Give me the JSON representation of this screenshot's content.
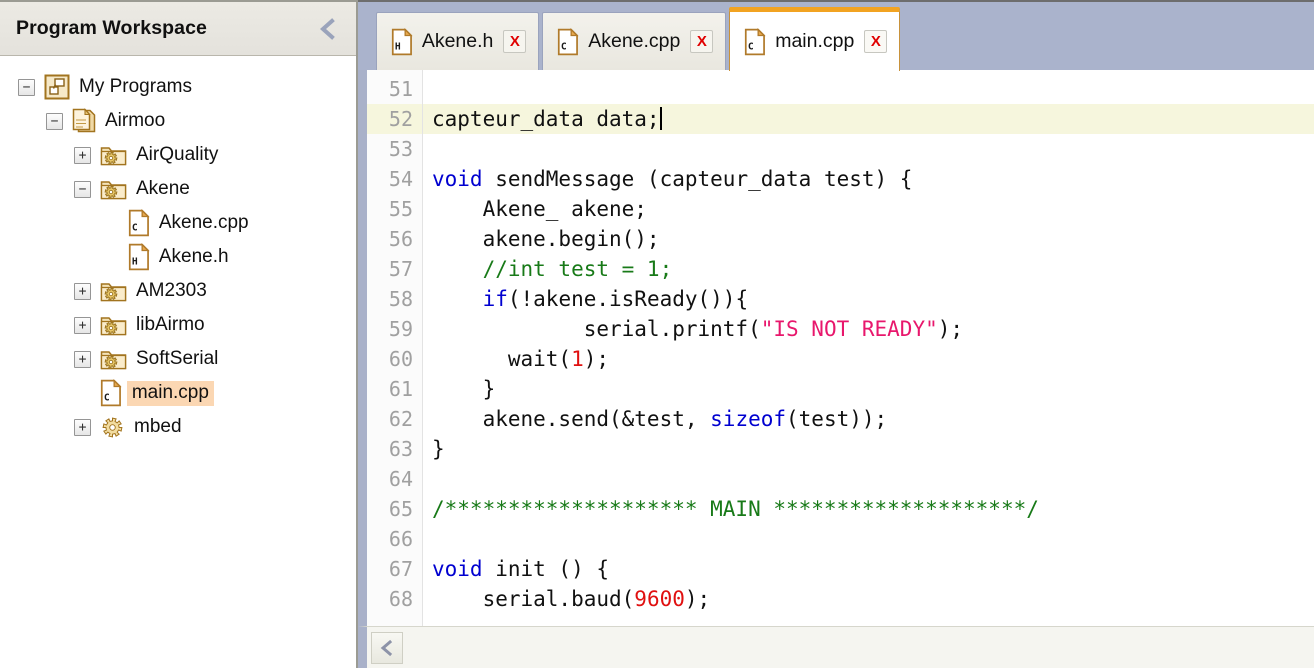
{
  "sidebar": {
    "title": "Program Workspace",
    "collapse_icon": "chevron-left-icon",
    "tree": [
      {
        "label": "My Programs",
        "icon": "programs-icon",
        "toggle": "−",
        "indent": 0,
        "selected": false
      },
      {
        "label": "Airmoo",
        "icon": "program-icon",
        "toggle": "−",
        "indent": 1,
        "selected": false
      },
      {
        "label": "AirQuality",
        "icon": "library-icon",
        "toggle": "+",
        "indent": 2,
        "selected": false
      },
      {
        "label": "Akene",
        "icon": "library-icon",
        "toggle": "−",
        "indent": 2,
        "selected": false
      },
      {
        "label": "Akene.cpp",
        "icon": "cpp-file-icon",
        "toggle": "",
        "indent": 3,
        "selected": false
      },
      {
        "label": "Akene.h",
        "icon": "h-file-icon",
        "toggle": "",
        "indent": 3,
        "selected": false
      },
      {
        "label": "AM2303",
        "icon": "library-icon",
        "toggle": "+",
        "indent": 2,
        "selected": false
      },
      {
        "label": "libAirmo",
        "icon": "library-icon",
        "toggle": "+",
        "indent": 2,
        "selected": false
      },
      {
        "label": "SoftSerial",
        "icon": "library-icon",
        "toggle": "+",
        "indent": 2,
        "selected": false
      },
      {
        "label": "main.cpp",
        "icon": "cpp-file-icon",
        "toggle": "",
        "indent": 2,
        "selected": true
      },
      {
        "label": "mbed",
        "icon": "gear-icon",
        "toggle": "+",
        "indent": 2,
        "selected": false
      }
    ]
  },
  "editor": {
    "tabs": [
      {
        "label": "Akene.h",
        "icon": "h-file-icon",
        "close": "X",
        "active": false
      },
      {
        "label": "Akene.cpp",
        "icon": "cpp-file-icon",
        "close": "X",
        "active": false
      },
      {
        "label": "main.cpp",
        "icon": "cpp-file-icon",
        "close": "X",
        "active": true
      }
    ],
    "scroll_left_icon": "chevron-left-icon",
    "first_line_number": 51,
    "cursor_line": 52,
    "lines": [
      {
        "n": 51,
        "tokens": []
      },
      {
        "n": 52,
        "tokens": [
          {
            "t": "capteur_data data;",
            "c": ""
          }
        ],
        "caret": true
      },
      {
        "n": 53,
        "tokens": []
      },
      {
        "n": 54,
        "tokens": [
          {
            "t": "void",
            "c": "kw"
          },
          {
            "t": " sendMessage (capteur_data test) {",
            "c": ""
          }
        ]
      },
      {
        "n": 55,
        "tokens": [
          {
            "t": "    Akene_ akene;",
            "c": ""
          }
        ]
      },
      {
        "n": 56,
        "tokens": [
          {
            "t": "    akene.begin();",
            "c": ""
          }
        ]
      },
      {
        "n": 57,
        "tokens": [
          {
            "t": "    //int test = 1;",
            "c": "cmt"
          }
        ]
      },
      {
        "n": 58,
        "tokens": [
          {
            "t": "    ",
            "c": ""
          },
          {
            "t": "if",
            "c": "kw"
          },
          {
            "t": "(!akene.isReady()){",
            "c": ""
          }
        ]
      },
      {
        "n": 59,
        "tokens": [
          {
            "t": "            serial.printf(",
            "c": ""
          },
          {
            "t": "\"IS NOT READY\"",
            "c": "str"
          },
          {
            "t": ");",
            "c": ""
          }
        ]
      },
      {
        "n": 60,
        "tokens": [
          {
            "t": "      wait(",
            "c": ""
          },
          {
            "t": "1",
            "c": "num"
          },
          {
            "t": ");",
            "c": ""
          }
        ]
      },
      {
        "n": 61,
        "tokens": [
          {
            "t": "    }",
            "c": ""
          }
        ]
      },
      {
        "n": 62,
        "tokens": [
          {
            "t": "    akene.send(&test, ",
            "c": ""
          },
          {
            "t": "sizeof",
            "c": "kw"
          },
          {
            "t": "(test));",
            "c": ""
          }
        ]
      },
      {
        "n": 63,
        "tokens": [
          {
            "t": "}",
            "c": ""
          }
        ]
      },
      {
        "n": 64,
        "tokens": []
      },
      {
        "n": 65,
        "tokens": [
          {
            "t": "/******************** MAIN ********************/",
            "c": "cmt"
          }
        ]
      },
      {
        "n": 66,
        "tokens": []
      },
      {
        "n": 67,
        "tokens": [
          {
            "t": "void",
            "c": "kw"
          },
          {
            "t": " init () {",
            "c": ""
          }
        ]
      },
      {
        "n": 68,
        "tokens": [
          {
            "t": "    serial.baud(",
            "c": ""
          },
          {
            "t": "9600",
            "c": "num"
          },
          {
            "t": ");",
            "c": ""
          }
        ]
      }
    ]
  },
  "colors": {
    "tabbar_bg": "#aab3cc",
    "active_tab_top": "#f2a321",
    "selection": "#fbd7b3",
    "current_line": "#f6f6dd",
    "keyword": "#0000d0",
    "comment": "#187a18",
    "string": "#e8176c",
    "number": "#e01010",
    "close_x": "#e00000"
  }
}
